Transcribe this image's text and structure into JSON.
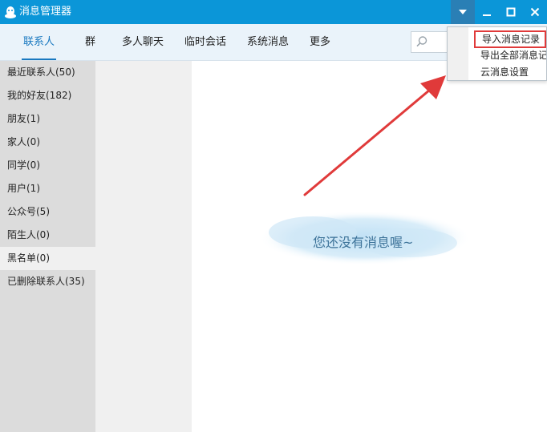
{
  "window": {
    "title": "消息管理器",
    "logo_icon": "qq-penguin-icon",
    "controls": [
      "dropdown-triangle-icon",
      "minimize-icon",
      "maximize-icon",
      "close-icon"
    ]
  },
  "tabs": [
    {
      "label": "联系人",
      "active": true
    },
    {
      "label": "群"
    },
    {
      "label": "多人聊天"
    },
    {
      "label": "临时会话"
    },
    {
      "label": "系统消息"
    },
    {
      "label": "更多"
    }
  ],
  "search": {
    "icon": "search-icon",
    "placeholder": ""
  },
  "sidebar": {
    "items": [
      {
        "label": "最近联系人(50)"
      },
      {
        "label": "我的好友(182)"
      },
      {
        "label": "朋友(1)"
      },
      {
        "label": "家人(0)"
      },
      {
        "label": "同学(0)"
      },
      {
        "label": "用户(1)"
      },
      {
        "label": "公众号(5)"
      },
      {
        "label": "陌生人(0)"
      },
      {
        "label": "黑名单(0)",
        "selected": true
      },
      {
        "label": "已删除联系人(35)"
      }
    ]
  },
  "empty_state": {
    "text": "您还没有消息喔~"
  },
  "dropdown_menu": {
    "items": [
      {
        "label": "导入消息记录",
        "highlighted": true
      },
      {
        "label": "导出全部消息记"
      },
      {
        "label": "云消息设置"
      }
    ]
  },
  "colors": {
    "titlebar": "#0b96d8",
    "accent": "#1a79c0",
    "annotation": "#e03a3a"
  }
}
